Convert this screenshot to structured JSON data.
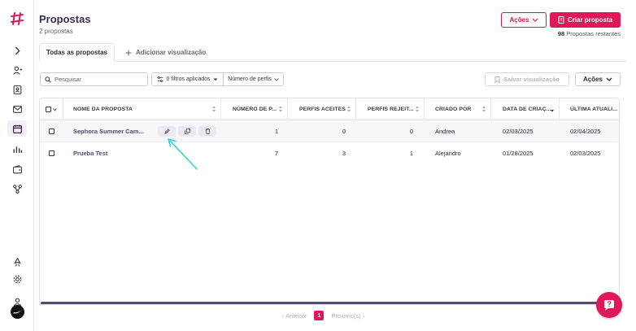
{
  "header": {
    "title": "Propostas",
    "subtitle": "2 propostas",
    "actions_label": "Ações",
    "create_label": "Criar proposta",
    "remaining_count": "98",
    "remaining_label": "Propostas restantes"
  },
  "tabs": [
    {
      "label": "Todas as propostas"
    },
    {
      "label": "Adicionar visualização"
    }
  ],
  "toolbar": {
    "search_placeholder": "Pesquisar",
    "filters_label": "0 filtros aplicados",
    "profile_count_label": "Número de perfis",
    "save_view_label": "Salvar visualização",
    "actions_label": "Ações"
  },
  "table": {
    "columns": [
      "NOME DA PROPOSTA",
      "NÚMERO DE P...",
      "PERFIS ACEITES",
      "PERFIS REJEIT...",
      "CRIADO POR",
      "DATA DE CRIAÇ...",
      "ÚLTIMA ATUALI..."
    ],
    "rows": [
      {
        "name": "Sephora Summer Cam...",
        "profiles": "1",
        "accepted": "0",
        "rejected": "0",
        "created_by": "Andrea",
        "created_at": "02/03/2025",
        "updated_at": "02/04/2025"
      },
      {
        "name": "Prueba Test",
        "profiles": "7",
        "accepted": "3",
        "rejected": "1",
        "created_by": "Alejandro",
        "created_at": "01/28/2025",
        "updated_at": "02/03/2025"
      }
    ]
  },
  "pagination": {
    "prev_label": "Anterior",
    "current_page": "1",
    "next_label": "Próximo(s)"
  },
  "colors": {
    "accent": "#e0185a",
    "primary_text": "#3b2a4a",
    "annotation_arrow": "#2fd3e0"
  }
}
